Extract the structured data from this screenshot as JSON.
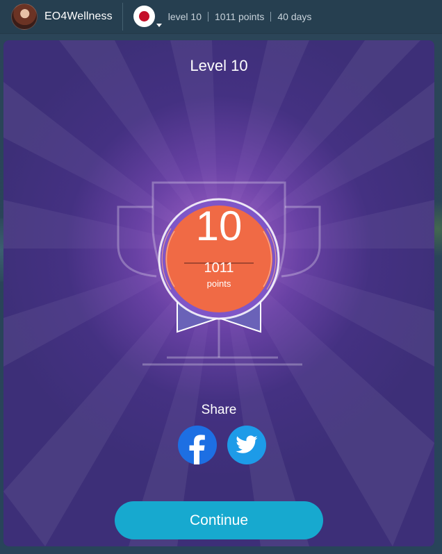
{
  "topbar": {
    "username": "EO4Wellness",
    "stats": [
      "level 10",
      "1011 points",
      "40 days"
    ]
  },
  "card": {
    "title": "Level 10",
    "medal": {
      "level_number": "10",
      "points_value": "1011",
      "points_label": "points"
    },
    "share_label": "Share",
    "continue_label": "Continue"
  },
  "colors": {
    "card_bg": "#3d2f78",
    "medal_orange": "#f06a45",
    "continue_button": "#17a9cf",
    "facebook": "#1d6fe3",
    "twitter": "#1d9be8"
  },
  "icons": {
    "facebook": "facebook-icon",
    "twitter": "twitter-icon",
    "flag": "japan-flag-icon",
    "caret": "caret-down-icon"
  }
}
